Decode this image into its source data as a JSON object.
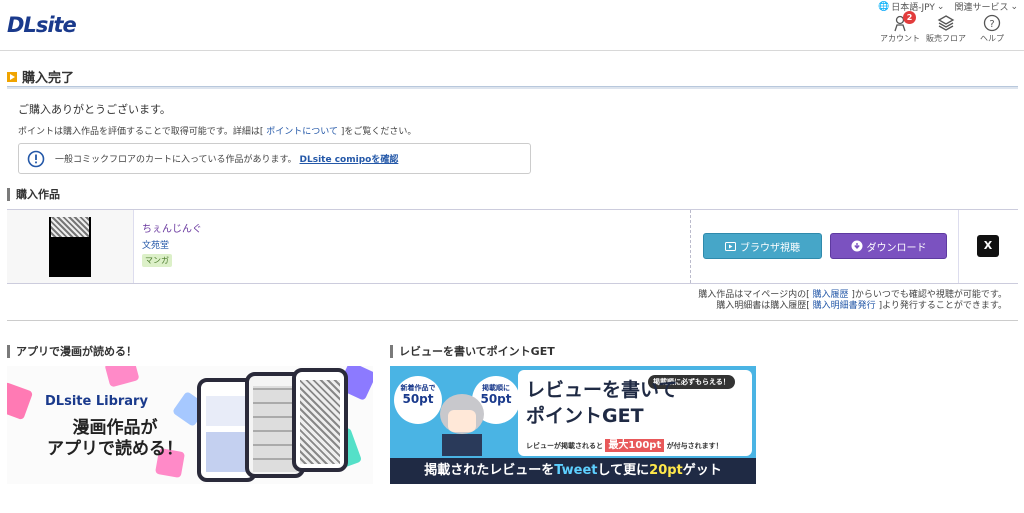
{
  "header": {
    "logo": "DLsite",
    "language": "日本語-JPY",
    "related": "関連サービス",
    "icons": [
      {
        "name": "account",
        "label": "アカウント",
        "badge": "2"
      },
      {
        "name": "sales-floor",
        "label": "販売フロア"
      },
      {
        "name": "help",
        "label": "ヘルプ"
      }
    ]
  },
  "page": {
    "title": "購入完了",
    "thanks": "ご購入ありがとうございます。",
    "points_prefix": "ポイントは購入作品を評価することで取得可能です。詳細は[",
    "points_link": "ポイントについて",
    "points_suffix": "]をご覧ください。",
    "notice_text": "一般コミックフロアのカートに入っている作品があります。",
    "notice_link": "DLsite comipoを確認"
  },
  "purchased": {
    "heading": "購入作品",
    "item": {
      "title": "ちぇんじんぐ",
      "circle": "文苑堂",
      "tag": "マンガ",
      "browser_button": "ブラウザ視聴",
      "download_button": "ダウンロード",
      "share": "X"
    },
    "note_line1_a": "購入作品はマイページ内の[",
    "note_line1_link": "購入履歴",
    "note_line1_b": "]からいつでも確認や視聴が可能です。",
    "note_line2_a": "購入明細書は購入履歴[",
    "note_line2_link": "購入明細書発行",
    "note_line2_b": "]より発行することができます。"
  },
  "banners": {
    "app": {
      "heading": "アプリで漫画が読める！",
      "logo": "DLsite Library",
      "line1": "漫画作品が",
      "line2": "アプリで読める！"
    },
    "review": {
      "heading": "レビューを書いてポイントGET",
      "bubble1_top": "新着作品で",
      "bubble1_value": "50pt",
      "bubble2_top": "掲載順に",
      "bubble2_value": "50pt",
      "tag": "掲載順に必ずもらえる！",
      "title_line1": "レビューを書いて",
      "title_line2": "ポイントGET",
      "max_prefix": "レビューが掲載されると",
      "max_value": "最大100pt",
      "max_suffix": "が付与されます！",
      "bottom_a": "掲載されたレビューを",
      "bottom_tweet": "Tweet",
      "bottom_b": "して更に",
      "bottom_pt": "20pt",
      "bottom_c": "ゲット"
    }
  },
  "colors": {
    "brand": "#1a3a8c",
    "browser_button": "#46a6c8",
    "download_button": "#7b52c0",
    "link": "#2458a8",
    "title_marker": "#f0a400"
  }
}
